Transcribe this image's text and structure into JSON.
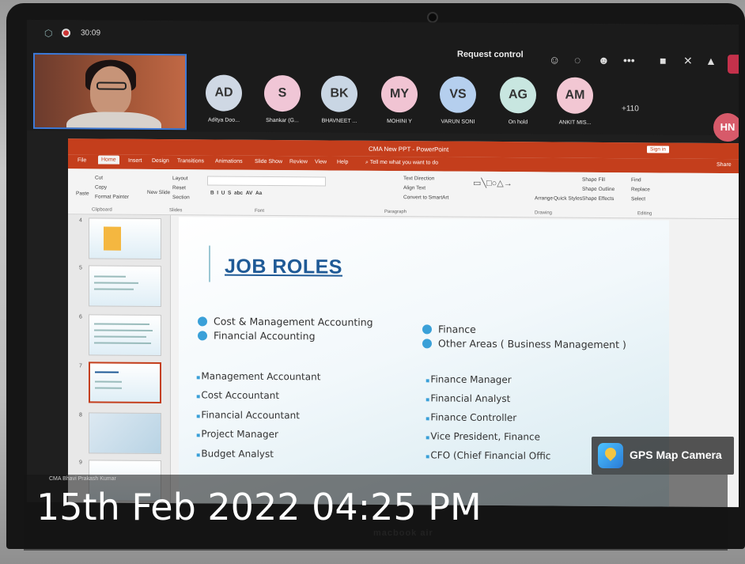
{
  "teams": {
    "timer": "30:09",
    "request_control": "Request control",
    "participants": [
      {
        "initials": "AD",
        "name": "Aditya Doo...",
        "color": "#cfd8e4"
      },
      {
        "initials": "S",
        "name": "Shankar (G...",
        "color": "#f0c6d6"
      },
      {
        "initials": "BK",
        "name": "BHAVNEET ...",
        "color": "#c9d6e4"
      },
      {
        "initials": "MY",
        "name": "MOHINI Y",
        "color": "#f1c4d3"
      },
      {
        "initials": "VS",
        "name": "VARUN SONI",
        "color": "#b5cfee"
      },
      {
        "initials": "AG",
        "name": "On hold",
        "color": "#c8e6e0"
      },
      {
        "initials": "AM",
        "name": "ANKIT MIS...",
        "color": "#f2c7d3"
      }
    ],
    "more_count": "+110",
    "self_initials": "HN"
  },
  "ppt": {
    "title": "CMA New PPT - PowerPoint",
    "sign_in": "Sign in",
    "share": "Share",
    "tabs": [
      "File",
      "Home",
      "Insert",
      "Design",
      "Transitions",
      "Animations",
      "Slide Show",
      "Review",
      "View",
      "Help"
    ],
    "tell_me": "Tell me what you want to do",
    "ribbon": {
      "paste": "Paste",
      "cut": "Cut",
      "copy": "Copy",
      "format_painter": "Format Painter",
      "clipboard": "Clipboard",
      "new_slide": "New Slide",
      "layout": "Layout",
      "reset": "Reset",
      "section": "Section",
      "slides": "Slides",
      "font": "Font",
      "paragraph": "Paragraph",
      "text_direction": "Text Direction",
      "align_text": "Align Text",
      "convert_smartart": "Convert to SmartArt",
      "arrange": "Arrange",
      "quick_styles": "Quick Styles",
      "shape_fill": "Shape Fill",
      "shape_outline": "Shape Outline",
      "shape_effects": "Shape Effects",
      "drawing": "Drawing",
      "find": "Find",
      "replace": "Replace",
      "select": "Select",
      "editing": "Editing"
    },
    "thumb_numbers": [
      "4",
      "5",
      "6",
      "7",
      "8",
      "9"
    ]
  },
  "slide": {
    "title": "JOB ROLES",
    "left_heads": [
      "Cost & Management Accounting",
      "Financial Accounting"
    ],
    "right_heads": [
      "Finance",
      "Other Areas ( Business Management )"
    ],
    "left_roles": [
      "Management Accountant",
      "Cost Accountant",
      "Financial Accountant",
      "Project Manager",
      "Budget Analyst"
    ],
    "right_roles": [
      "Finance Manager",
      "Financial Analyst",
      "Finance Controller",
      "Vice President, Finance",
      "CFO (Chief Financial Offic"
    ]
  },
  "overlay": {
    "gps_label": "GPS Map Camera",
    "datestamp": "15th Feb 2022 04:25 PM",
    "caption": "CMA Bhavi Prakash Kumar",
    "brand": "macbook air"
  }
}
